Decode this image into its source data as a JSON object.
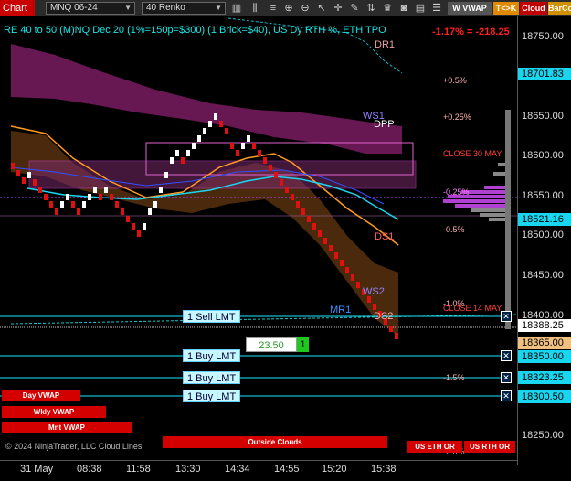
{
  "toolbar": {
    "chart_label": "Chart",
    "instrument": "MNQ 06-24",
    "bar_type": "40 Renko",
    "btn_vwap": "W VWAP",
    "btn_tk": "T<>K",
    "btn_cloud": "Cloud",
    "btn_barco": "BarCo"
  },
  "header": {
    "title": "RE 40 to 50 (M)NQ Dec 20 (1%=150p=$300) (1 Brick=$40), US Dy RTH %, ETH TPO",
    "pnl": "-1.17% = -218.25"
  },
  "price_axis": {
    "ticks": [
      "18750.00",
      "18650.00",
      "18600.00",
      "18550.00",
      "18500.00",
      "18450.00",
      "18400.00",
      "18350.00",
      "18300.50",
      "18250.00"
    ],
    "tags": {
      "high": "18701.83",
      "mid": "18521.16",
      "last": "18388.25",
      "current": "18365.00",
      "t1": "18350.00",
      "t2": "18323.25",
      "t3": "18300.50"
    }
  },
  "time_axis": [
    "31 May",
    "08:38",
    "11:58",
    "13:30",
    "14:34",
    "14:55",
    "15:20",
    "15:38"
  ],
  "levels": {
    "dr1": "DR1",
    "ws1": "WS1",
    "dpp": "DPP",
    "ds1": "DS1",
    "ws2": "WS2",
    "mr1": "MR1",
    "ds2": "DS2",
    "p05": "+0.5%",
    "p025": "+0.25%",
    "m025": "-0.25%",
    "m05": "-0.5%",
    "m10": "-1.0%",
    "m15": "-1.5%",
    "m20": "-2.0%",
    "close30": "CLOSE 30 MAY",
    "close14": "CLOSE 14 MAY"
  },
  "orders": {
    "sell_lmt": "1 Sell LMT",
    "buy1": "1 Buy LMT",
    "buy2": "1 Buy LMT",
    "buy3": "1 Buy LMT",
    "qty_value": "23.50",
    "qty_count": "1"
  },
  "indicator_buttons": {
    "day_vwap": "Day VWAP",
    "wkly_vwap": "Wkly VWAP",
    "mnt_vwap": "Mnt VWAP",
    "outside_clouds": "Outside Clouds",
    "us_eth_or": "US ETH OR",
    "us_rth_or": "US RTH OR"
  },
  "copyright": "© 2024 NinjaTrader, LLC Cloud Lines"
}
